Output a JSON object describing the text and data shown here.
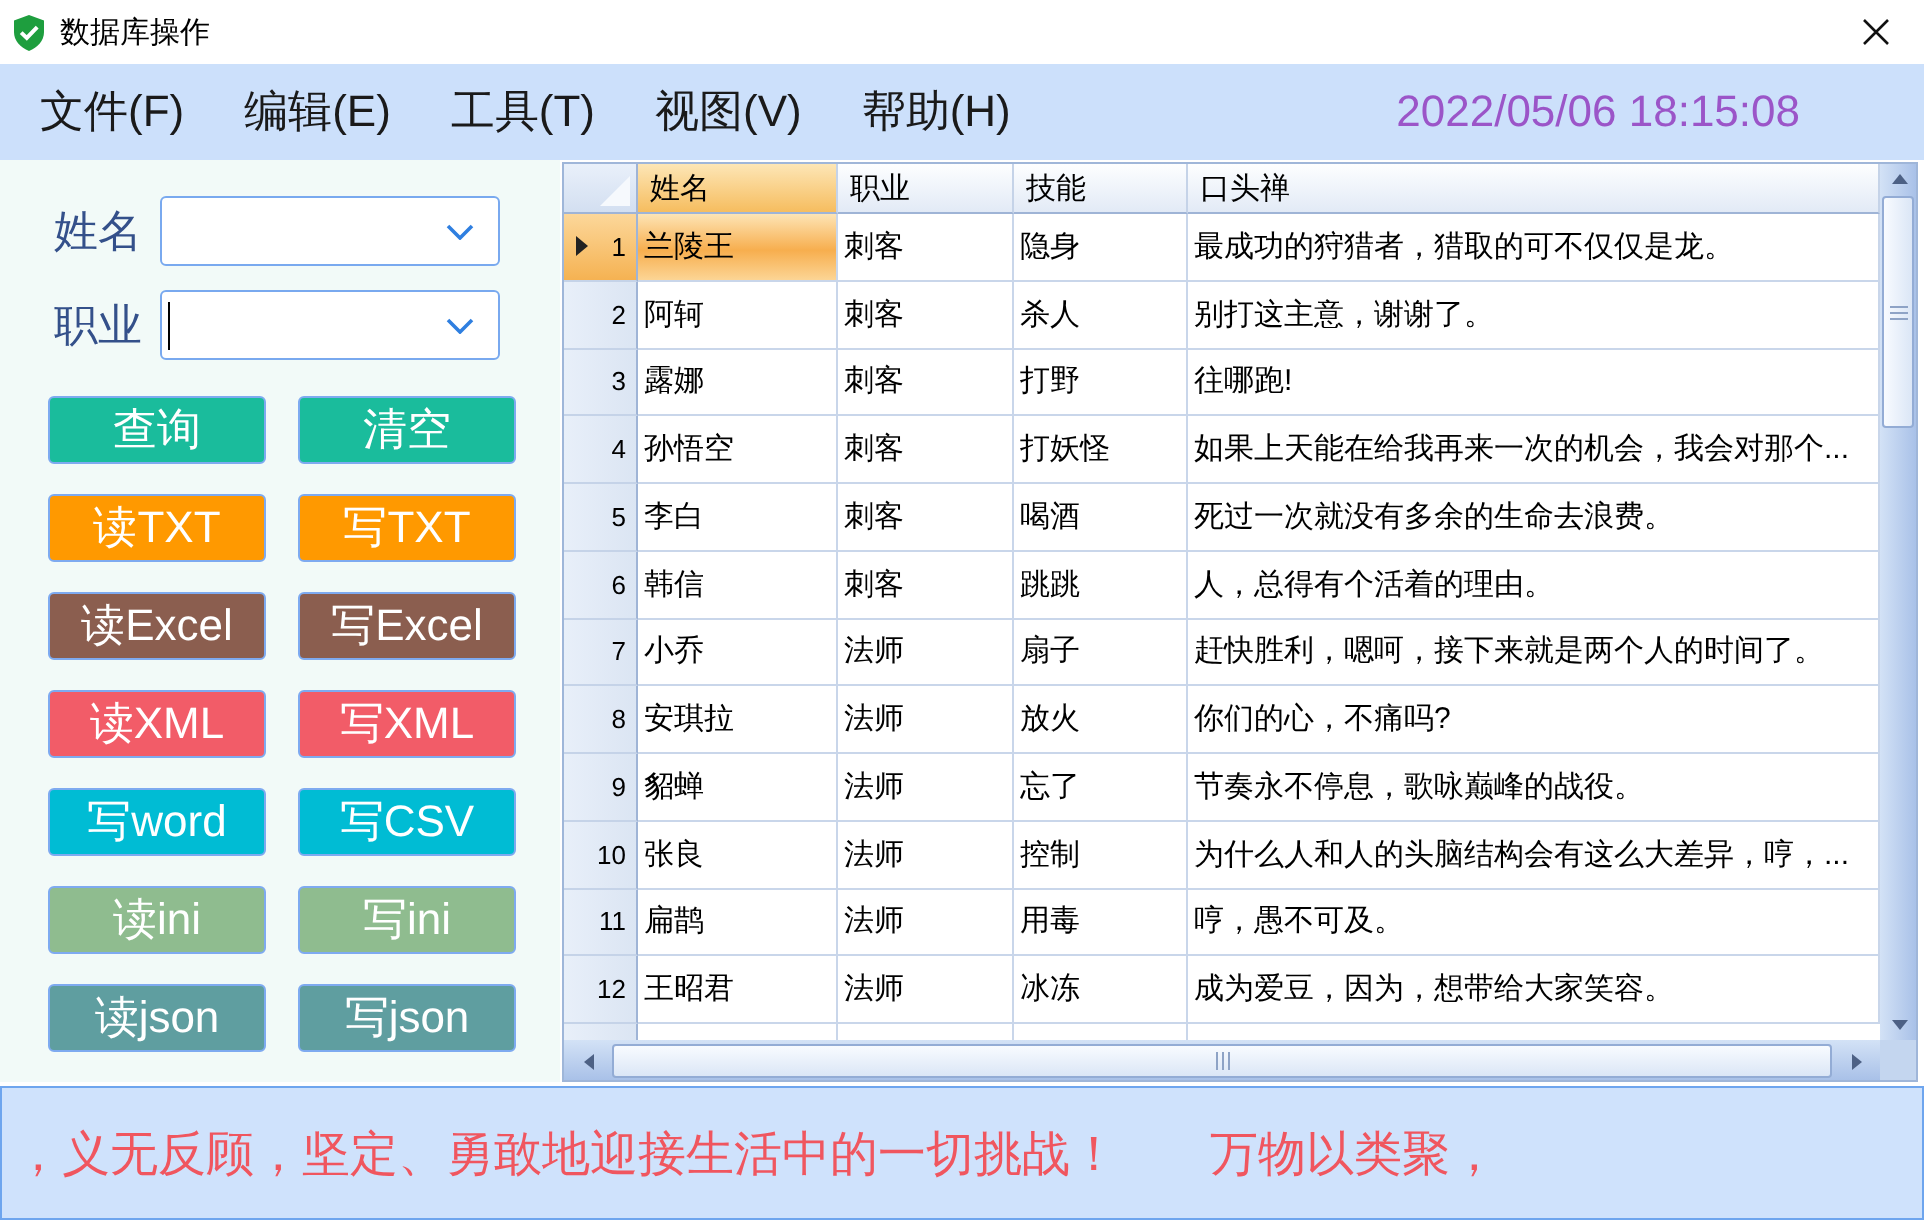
{
  "window": {
    "title": "数据库操作"
  },
  "menu": {
    "items": [
      {
        "label": "文件(F)"
      },
      {
        "label": "编辑(E)"
      },
      {
        "label": "工具(T)"
      },
      {
        "label": "视图(V)"
      },
      {
        "label": "帮助(H)"
      }
    ],
    "clock": "2022/05/06 18:15:08"
  },
  "search": {
    "fields": [
      {
        "label": "姓名",
        "focused": false
      },
      {
        "label": "职业",
        "focused": true
      }
    ]
  },
  "buttons": [
    {
      "label": "查询",
      "color": "#1abc9c"
    },
    {
      "label": "清空",
      "color": "#1abc9c"
    },
    {
      "label": "读TXT",
      "color": "#ff9900"
    },
    {
      "label": "写TXT",
      "color": "#ff9900"
    },
    {
      "label": "读Excel",
      "color": "#8b5e4f"
    },
    {
      "label": "写Excel",
      "color": "#8b5e4f"
    },
    {
      "label": "读XML",
      "color": "#f25c68"
    },
    {
      "label": "写XML",
      "color": "#f25c68"
    },
    {
      "label": "写word",
      "color": "#00bcd4"
    },
    {
      "label": "写CSV",
      "color": "#00bcd4"
    },
    {
      "label": "读ini",
      "color": "#8fbc8f"
    },
    {
      "label": "写ini",
      "color": "#8fbc8f"
    },
    {
      "label": "读json",
      "color": "#5f9ea0"
    },
    {
      "label": "写json",
      "color": "#5f9ea0"
    }
  ],
  "table": {
    "columns": [
      {
        "label": "姓名",
        "selected": true
      },
      {
        "label": "职业",
        "selected": false
      },
      {
        "label": "技能",
        "selected": false
      },
      {
        "label": "口头禅",
        "selected": false
      }
    ],
    "rows": [
      {
        "number": "1",
        "selected": true,
        "cells": [
          "兰陵王",
          "刺客",
          "隐身",
          "最成功的狩猎者，猎取的可不仅仅是龙。"
        ]
      },
      {
        "number": "2",
        "selected": false,
        "cells": [
          "阿轲",
          "刺客",
          "杀人",
          "别打这主意，谢谢了。"
        ]
      },
      {
        "number": "3",
        "selected": false,
        "cells": [
          "露娜",
          "刺客",
          "打野",
          "往哪跑!"
        ]
      },
      {
        "number": "4",
        "selected": false,
        "cells": [
          "孙悟空",
          "刺客",
          "打妖怪",
          "如果上天能在给我再来一次的机会，我会对那个..."
        ]
      },
      {
        "number": "5",
        "selected": false,
        "cells": [
          "李白",
          "刺客",
          "喝酒",
          "死过一次就没有多余的生命去浪费。"
        ]
      },
      {
        "number": "6",
        "selected": false,
        "cells": [
          "韩信",
          "刺客",
          "跳跳",
          "人，总得有个活着的理由。"
        ]
      },
      {
        "number": "7",
        "selected": false,
        "cells": [
          "小乔",
          "法师",
          "扇子",
          "赶快胜利，嗯呵，接下来就是两个人的时间了。"
        ]
      },
      {
        "number": "8",
        "selected": false,
        "cells": [
          "安琪拉",
          "法师",
          "放火",
          "你们的心，不痛吗?"
        ]
      },
      {
        "number": "9",
        "selected": false,
        "cells": [
          "貂蝉",
          "法师",
          "忘了",
          "节奏永不停息，歌咏巅峰的战役。"
        ]
      },
      {
        "number": "10",
        "selected": false,
        "cells": [
          "张良",
          "法师",
          "控制",
          "为什么人和人的头脑结构会有这么大差异，哼，..."
        ]
      },
      {
        "number": "11",
        "selected": false,
        "cells": [
          "扁鹊",
          "法师",
          "用毒",
          "哼，愚不可及。"
        ]
      },
      {
        "number": "12",
        "selected": false,
        "cells": [
          "王昭君",
          "法师",
          "冰冻",
          "成为爱豆，因为，想带给大家笑容。"
        ]
      }
    ]
  },
  "marquee": {
    "texts": [
      "，义无反顾，坚定、勇敢地迎接生活中的一切挑战！",
      "万物以类聚，"
    ]
  }
}
